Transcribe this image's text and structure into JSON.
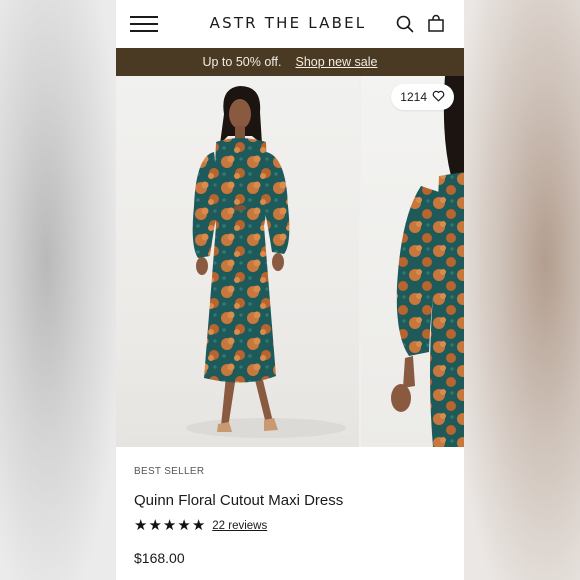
{
  "header": {
    "brand": "ASTR THE LABEL",
    "menu_icon": "hamburger-menu-icon",
    "search_icon": "search-icon",
    "cart_icon": "shopping-bag-icon"
  },
  "promo": {
    "text": "Up to 50% off.",
    "link": "Shop new sale"
  },
  "gallery": {
    "likes": "1214",
    "like_icon": "heart-icon"
  },
  "product": {
    "badge": "BEST SELLER",
    "title": "Quinn Floral Cutout Maxi Dress",
    "rating": 5,
    "rating_max": 5,
    "reviews": "22 reviews",
    "price": "$168.00"
  },
  "colors": {
    "promo_bg": "#4a3a23",
    "dress_teal": "#1f5a5a",
    "dress_rust": "#c8773d"
  }
}
